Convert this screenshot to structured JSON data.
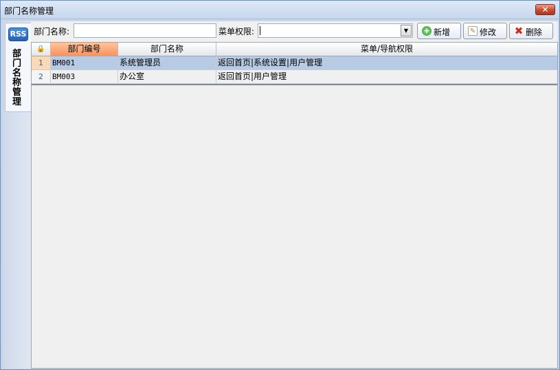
{
  "window": {
    "title": "部门名称管理",
    "close_label": "✕"
  },
  "sidebar": {
    "icon_text": "RSS",
    "tab_label": "部门名称管理"
  },
  "toolbar": {
    "dept_name_label": "部门名称:",
    "dept_name_value": "",
    "menu_perm_label": "菜单权限:",
    "menu_perm_value": "",
    "add_label": "新增",
    "edit_label": "修改",
    "delete_label": "删除"
  },
  "table": {
    "corner_icon": "🔒",
    "columns": [
      "部门编号",
      "部门名称",
      "菜单/导航权限"
    ],
    "rows": [
      {
        "num": "1",
        "code": "BM001",
        "name": "系统管理员",
        "perm": "返回首页|系统设置|用户管理"
      },
      {
        "num": "2",
        "code": "BM003",
        "name": "办公室",
        "perm": "返回首页|用户管理"
      }
    ]
  }
}
